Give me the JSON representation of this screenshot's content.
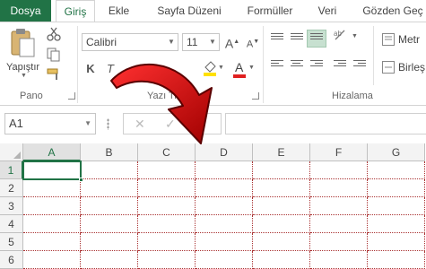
{
  "tabs": {
    "file": "Dosya",
    "items": [
      "Giriş",
      "Ekle",
      "Sayfa Düzeni",
      "Formüller",
      "Veri",
      "Gözden Geç"
    ]
  },
  "ribbon": {
    "clipboard": {
      "paste_label": "Yapıştır",
      "group_label": "Pano"
    },
    "font": {
      "font_name": "Calibri",
      "font_size": "11",
      "grow_label": "A",
      "shrink_label": "A",
      "italic_label": "T",
      "bold_label": "K",
      "color_label": "A",
      "group_label": "Yazı Ti"
    },
    "alignment": {
      "group_label": "Hizalama",
      "wrap_label": "Metr",
      "merge_label": "Birleş"
    }
  },
  "formula_bar": {
    "name_box": "A1",
    "cancel_label": "✕",
    "enter_label": "✓",
    "fx_label": "fx"
  },
  "grid": {
    "columns": [
      "A",
      "B",
      "C",
      "D",
      "E",
      "F",
      "G"
    ],
    "rows": [
      "1",
      "2",
      "3",
      "4",
      "5",
      "6"
    ],
    "active_cell": "A1"
  },
  "colors": {
    "accent": "#217346",
    "page_break": "#aa3333",
    "arrow": "#d01010"
  }
}
